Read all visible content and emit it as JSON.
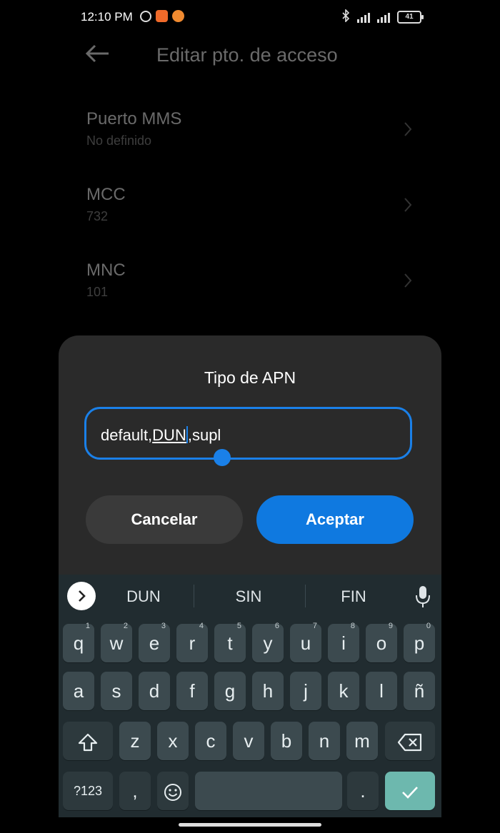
{
  "status_bar": {
    "time": "12:10 PM",
    "battery": "41"
  },
  "header": {
    "title": "Editar pto. de acceso"
  },
  "settings": [
    {
      "title": "Puerto MMS",
      "value": "No definido"
    },
    {
      "title": "MCC",
      "value": "732"
    },
    {
      "title": "MNC",
      "value": "101"
    }
  ],
  "dialog": {
    "title": "Tipo de APN",
    "input": {
      "before": "default,",
      "selected": "DUN",
      "after": ",supl"
    },
    "cancel_label": "Cancelar",
    "accept_label": "Aceptar",
    "accent_color": "#0f79e0"
  },
  "keyboard": {
    "suggestions": [
      "DUN",
      "SIN",
      "FIN"
    ],
    "row1": [
      {
        "key": "q",
        "hint": "1"
      },
      {
        "key": "w",
        "hint": "2"
      },
      {
        "key": "e",
        "hint": "3"
      },
      {
        "key": "r",
        "hint": "4"
      },
      {
        "key": "t",
        "hint": "5"
      },
      {
        "key": "y",
        "hint": "6"
      },
      {
        "key": "u",
        "hint": "7"
      },
      {
        "key": "i",
        "hint": "8"
      },
      {
        "key": "o",
        "hint": "9"
      },
      {
        "key": "p",
        "hint": "0"
      }
    ],
    "row2": [
      "a",
      "s",
      "d",
      "f",
      "g",
      "h",
      "j",
      "k",
      "l",
      "ñ"
    ],
    "row3": [
      "z",
      "x",
      "c",
      "v",
      "b",
      "n",
      "m"
    ],
    "symbols_label": "?123",
    "comma": ",",
    "period": ".",
    "icons": [
      "chevron-right-icon",
      "mic-icon",
      "shift-icon",
      "backspace-icon",
      "emoji-icon",
      "check-icon"
    ]
  }
}
